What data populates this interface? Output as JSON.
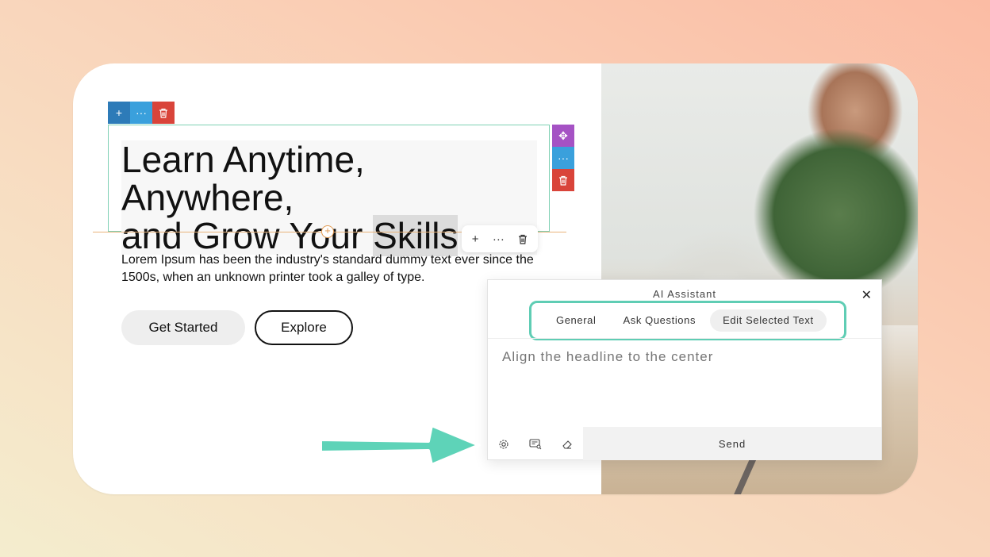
{
  "headline": {
    "line1": "Learn Anytime, Anywhere,",
    "line2_pre": "and Grow Your ",
    "line2_sel": "Skills"
  },
  "paragraph": "Lorem Ipsum has been the industry's standard dummy text ever since the 1500s, when an unknown printer took a galley of type.",
  "buttons": {
    "primary": "Get Started",
    "secondary": "Explore"
  },
  "ai_assistant": {
    "title": "AI Assistant",
    "tabs": [
      {
        "label": "General"
      },
      {
        "label": "Ask Questions"
      },
      {
        "label": "Edit Selected Text"
      }
    ],
    "active_tab": "Edit Selected Text",
    "input_placeholder": "Align the headline to the center",
    "send_label": "Send"
  },
  "toolbar_colors": {
    "add": "#2d7bb8",
    "more": "#3aa0dc",
    "delete": "#d9443a",
    "move": "#a552c4"
  },
  "accent": "#5fcdb4",
  "icons": [
    "plus-icon",
    "more-icon",
    "trash-icon",
    "move-icon",
    "gear-icon",
    "chat-search-icon",
    "eraser-icon",
    "close-icon",
    "arrow-icon"
  ]
}
